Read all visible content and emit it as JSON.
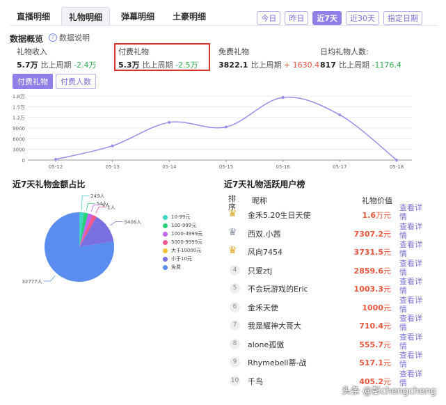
{
  "tabs": [
    {
      "label": "直播明细",
      "active": false
    },
    {
      "label": "礼物明细",
      "active": true
    },
    {
      "label": "弹幕明细",
      "active": false
    },
    {
      "label": "土豪明细",
      "active": false
    }
  ],
  "date_filters": [
    {
      "label": "今日",
      "active": false
    },
    {
      "label": "昨日",
      "active": false
    },
    {
      "label": "近7天",
      "active": true
    },
    {
      "label": "近30天",
      "active": false
    },
    {
      "label": "指定日期",
      "active": false
    }
  ],
  "overview": {
    "title": "数据概览",
    "help": "数据说明",
    "help_icon": "question-circle-icon",
    "stats": [
      {
        "label": "礼物收入",
        "value": "5.7万",
        "compare_label": "比上周期",
        "change": "-2.4万",
        "trend": "down"
      },
      {
        "label": "付费礼物",
        "value": "5.3万",
        "compare_label": "比上周期",
        "change": "-2.5万",
        "trend": "down"
      },
      {
        "label": "免费礼物",
        "value": "3822.1",
        "compare_label": "比上周期",
        "change": "+ 1630.4",
        "trend": "up"
      },
      {
        "label": "日均礼物人数:",
        "value": "817",
        "compare_label": "比上周期",
        "change": "-1176.4",
        "trend": "down"
      }
    ]
  },
  "chart_toggles": [
    {
      "label": "付费礼物",
      "active": true
    },
    {
      "label": "付费人数",
      "active": false
    }
  ],
  "chart_data": [
    {
      "type": "line",
      "categories": [
        "05-12",
        "05-13",
        "05-14",
        "05-15",
        "05-16",
        "05-17",
        "05-18"
      ],
      "values": [
        200,
        4000,
        10600,
        9300,
        17600,
        12700,
        0
      ],
      "ylim": [
        0,
        18000
      ],
      "yticks": [
        "0",
        "3000",
        "6000",
        "9000",
        "1.2万",
        "1.5万",
        "1.8万"
      ],
      "color": "#9b8ce8",
      "smooth": true,
      "grid": true
    },
    {
      "type": "pie",
      "title": "近7天礼物金额占比",
      "slices": [
        {
          "name": "10-99元",
          "value": 249,
          "label": "249人",
          "color": "#3dd6c4"
        },
        {
          "name": "100-999元",
          "value": 54,
          "label": "54人",
          "color": "#27d17a"
        },
        {
          "name": "1000-4999元",
          "value": 9,
          "label": "9人",
          "color": "#c066f0"
        },
        {
          "name": "5000-9999元",
          "value": 1,
          "label": "1人",
          "color": "#f0578a"
        },
        {
          "name": "大于10000元",
          "value": 0,
          "label": "",
          "color": "#f5c33b"
        },
        {
          "name": "小于10元",
          "value": 5406,
          "label": "5406人",
          "color": "#7a6fe0"
        },
        {
          "name": "免费",
          "value": 32777,
          "label": "32777人",
          "color": "#5b8cf0"
        }
      ],
      "legend": "right"
    }
  ],
  "ranking": {
    "title": "近7天礼物活跃用户榜",
    "col_rank": "排序",
    "col_name": "昵称",
    "col_value": "礼物价值",
    "detail_label": "查看详情",
    "crown_icon": "crown-icon",
    "rows": [
      {
        "rank": "1",
        "name": "金禾5.20生日天使",
        "num": "1.6",
        "unit": "万元"
      },
      {
        "rank": "2",
        "name": "西双.小茜",
        "num": "7307.2",
        "unit": "元"
      },
      {
        "rank": "3",
        "name": "风向7454",
        "num": "3731.5",
        "unit": "元"
      },
      {
        "rank": "4",
        "name": "只爱ztj",
        "num": "2859.6",
        "unit": "元"
      },
      {
        "rank": "5",
        "name": "不会玩游戏的Eric",
        "num": "1003.3",
        "unit": "元"
      },
      {
        "rank": "6",
        "name": "金禾天使",
        "num": "1000",
        "unit": "元"
      },
      {
        "rank": "7",
        "name": "我是耀神大哥大",
        "num": "710.4",
        "unit": "元"
      },
      {
        "rank": "8",
        "name": "alone孤傲",
        "num": "555.7",
        "unit": "元"
      },
      {
        "rank": "9",
        "name": "Rhymebell蒂-战",
        "num": "517.1",
        "unit": "元"
      },
      {
        "rank": "10",
        "name": "千鸟",
        "num": "405.2",
        "unit": "元"
      }
    ]
  },
  "watermark": "头条 @彭chengcheng"
}
